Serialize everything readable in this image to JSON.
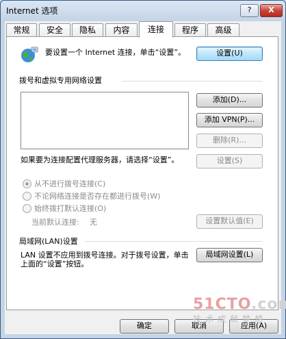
{
  "window": {
    "title": "Internet 选项",
    "help_glyph": "?",
    "close_glyph": "X"
  },
  "tabs": [
    "常规",
    "安全",
    "隐私",
    "内容",
    "连接",
    "程序",
    "高级"
  ],
  "active_tab_index": 4,
  "setup": {
    "text": "要设置一个 Internet 连接，单击“设置”。",
    "button": "设置(U)"
  },
  "dialup": {
    "group_label": "拨号和虚拟专用网络设置",
    "add_button": "添加(D)...",
    "add_vpn_button": "添加 VPN(P)...",
    "remove_button": "删除(R)...",
    "settings_button": "设置(S)",
    "proxy_text": "如果要为连接配置代理服务器，请选择“设置”。",
    "options": [
      "从不进行拨号连接(C)",
      "不论网络连接是否存在都进行拨号(W)",
      "始终拨打默认连接(O)"
    ],
    "selected_option": 0,
    "current_default_label": "当前默认连接:",
    "current_default_value": "无",
    "set_default_button": "设置默认值(E)"
  },
  "lan": {
    "group_label": "局域网(LAN)设置",
    "text": "LAN 设置不应用到拨号连接。对于拨号设置，单击上面的“设置”按钮。",
    "button": "局域网设置(L)"
  },
  "footer": {
    "ok": "确定",
    "cancel": "取消",
    "apply": "应用(A)"
  },
  "watermark": {
    "brand_a": "51CTO",
    "brand_b": ".com",
    "tagline": "技术成就梦想"
  },
  "colors": {
    "accent_button": "#bee6fd",
    "close_button": "#c7453b"
  }
}
